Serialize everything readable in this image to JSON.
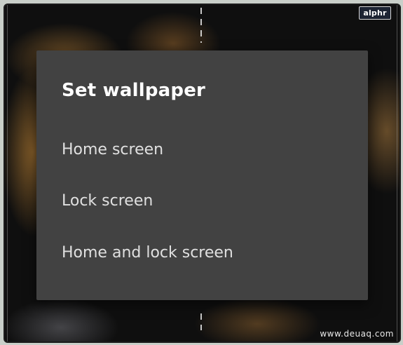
{
  "dialog": {
    "title": "Set wallpaper",
    "options": [
      {
        "label": "Home screen"
      },
      {
        "label": "Lock screen"
      },
      {
        "label": "Home and lock screen"
      }
    ]
  },
  "logo": {
    "text": "alphr"
  },
  "watermark": {
    "text": "www.deuaq.com"
  },
  "colors": {
    "dialog_background": "#424242",
    "title_text": "#ffffff",
    "option_text": "#e0e0e0"
  }
}
